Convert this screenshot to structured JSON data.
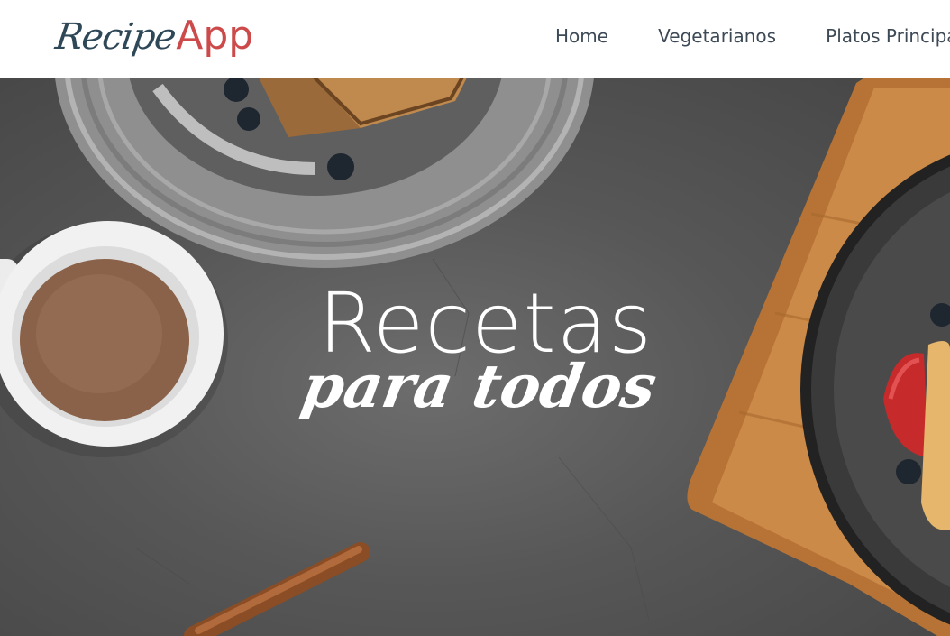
{
  "logo": {
    "script": "Recipe",
    "accent": "App"
  },
  "nav": {
    "items": [
      "Home",
      "Vegetarianos",
      "Platos Principales"
    ]
  },
  "hero": {
    "title": "Recetas",
    "subtitle": "para todos"
  },
  "colors": {
    "brand_dark": "#2f4858",
    "brand_accent": "#cc4a4a",
    "nav_text": "#3d4a56",
    "hero_text": "#ffffff"
  }
}
